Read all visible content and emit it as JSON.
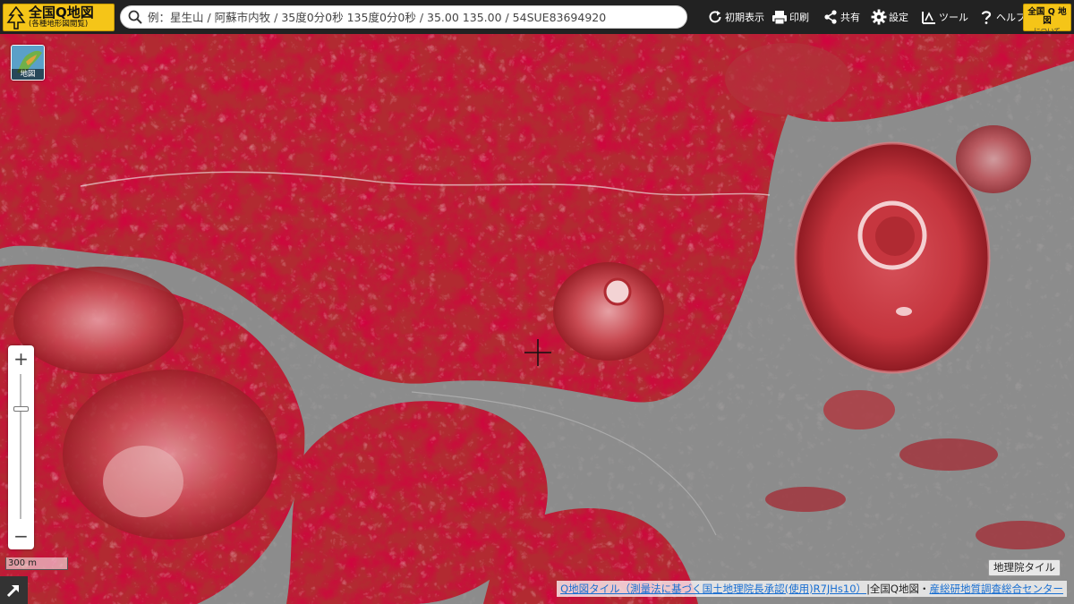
{
  "logo": {
    "title": "全国Q地図",
    "subtitle": "(各種地形図閲覧)"
  },
  "search": {
    "placeholder": "例：星生山 / 阿蘇市内牧 / 35度0分0秒 135度0分0秒 / 35.00 135.00 / 54SUE83694920"
  },
  "toolbar": {
    "reset": "初期表示",
    "print": "印刷",
    "share": "共有",
    "settings": "設定",
    "tools": "ツール",
    "help": "ヘルプ"
  },
  "about": {
    "line1": "全国 Q 地図",
    "line2": "について"
  },
  "basemap": {
    "label": "地図"
  },
  "zoom": {
    "in": "+",
    "out": "−",
    "level_fraction": 0.24
  },
  "scale": {
    "label": "300 m"
  },
  "tile_label": "地理院タイル",
  "attribution": {
    "link1": "Q地図タイル（測量法に基づく国土地理院長承認(使用)R7JHs10）",
    "sep": "|全国Q地図・",
    "link2": "産総研地質調査総合センター"
  },
  "icons": {
    "logo": "tree-icon",
    "search": "search-icon",
    "reset": "reload-icon",
    "print": "printer-icon",
    "share": "share-icon",
    "settings": "gear-icon",
    "tools": "tools-icon",
    "help": "question-icon",
    "corner": "expand-arrow-icon",
    "center": "crosshair-icon"
  },
  "colors": {
    "accent": "#f5c518",
    "toolbar": "#222222",
    "relief": "#c8242c",
    "link": "#1a6fd1"
  }
}
